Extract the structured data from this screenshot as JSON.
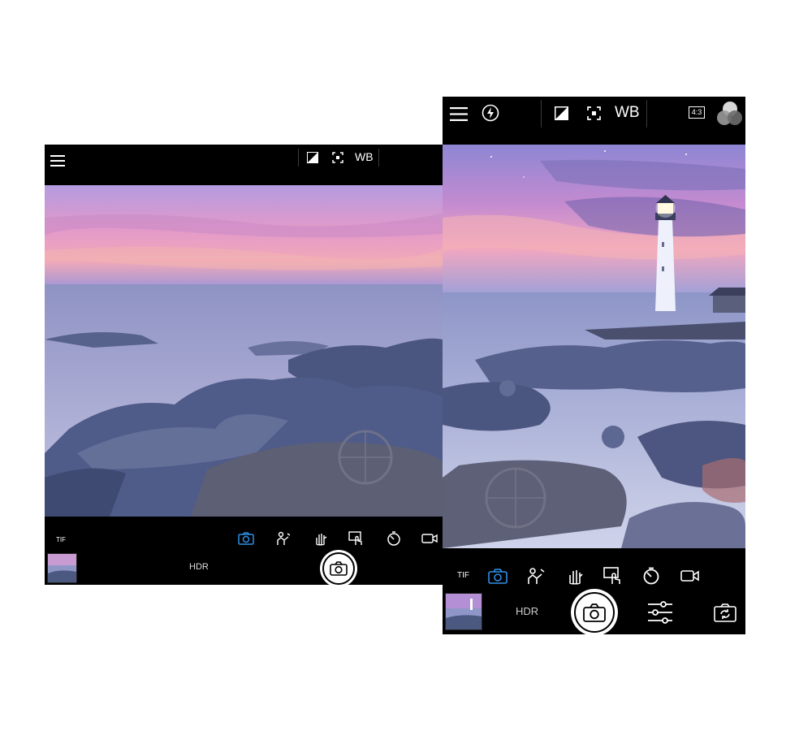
{
  "left_screen": {
    "topbar": {
      "wb_label": "WB"
    },
    "bottombar": {
      "format_label": "TIF",
      "hdr_label": "HDR",
      "active_mode": "photo",
      "modes": [
        "photo",
        "selfie",
        "gesture",
        "touch",
        "timer",
        "video"
      ]
    }
  },
  "right_screen": {
    "topbar": {
      "wb_label": "WB",
      "aspect_ratio": "4:3"
    },
    "bottombar": {
      "format_label": "TIF",
      "hdr_label": "HDR",
      "active_mode": "photo",
      "modes": [
        "photo",
        "selfie",
        "gesture",
        "touch",
        "timer",
        "video"
      ]
    }
  },
  "colors": {
    "accent": "#2f8fe6",
    "bar_background": "#000000",
    "icon": "#ffffff",
    "sky_top": "#9c8fd6",
    "sky_mid": "#e79ac8",
    "horizon": "#f4b6a8",
    "sea": "#8f95c8",
    "rock": "#4c5a86"
  },
  "icons": [
    "menu-icon",
    "flash-icon",
    "exposure-icon",
    "focus-icon",
    "camera-icon",
    "selfie-icon",
    "gesture-icon",
    "touch-icon",
    "timer-icon",
    "video-icon",
    "settings-sliders-icon",
    "switch-camera-icon",
    "filter-circles-icon"
  ]
}
